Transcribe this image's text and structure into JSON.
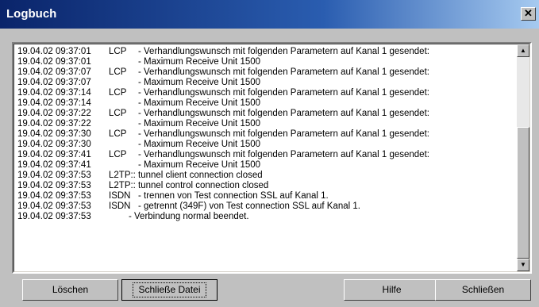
{
  "window": {
    "title": "Logbuch",
    "close_icon": "close-icon"
  },
  "log": {
    "lines": [
      {
        "date": "19.04.02 09:37:01",
        "type": "LCP",
        "message": "- Verhandlungswunsch mit folgenden Parametern auf Kanal 1 gesendet:"
      },
      {
        "date": "19.04.02 09:37:01",
        "type": "",
        "message": "- Maximum Receive Unit 1500"
      },
      {
        "date": "19.04.02 09:37:07",
        "type": "LCP",
        "message": "- Verhandlungswunsch mit folgenden Parametern auf Kanal 1 gesendet:"
      },
      {
        "date": "19.04.02 09:37:07",
        "type": "",
        "message": "- Maximum Receive Unit 1500"
      },
      {
        "date": "19.04.02 09:37:14",
        "type": "LCP",
        "message": "- Verhandlungswunsch mit folgenden Parametern auf Kanal 1 gesendet:"
      },
      {
        "date": "19.04.02 09:37:14",
        "type": "",
        "message": "- Maximum Receive Unit 1500"
      },
      {
        "date": "19.04.02 09:37:22",
        "type": "LCP",
        "message": "- Verhandlungswunsch mit folgenden Parametern auf Kanal 1 gesendet:"
      },
      {
        "date": "19.04.02 09:37:22",
        "type": "",
        "message": "- Maximum Receive Unit 1500"
      },
      {
        "date": "19.04.02 09:37:30",
        "type": "LCP",
        "message": "- Verhandlungswunsch mit folgenden Parametern auf Kanal 1 gesendet:"
      },
      {
        "date": "19.04.02 09:37:30",
        "type": "",
        "message": "- Maximum Receive Unit 1500"
      },
      {
        "date": "19.04.02 09:37:41",
        "type": "LCP",
        "message": "- Verhandlungswunsch mit folgenden Parametern auf Kanal 1 gesendet:"
      },
      {
        "date": "19.04.02 09:37:41",
        "type": "",
        "message": "- Maximum Receive Unit 1500"
      },
      {
        "date": "19.04.02 09:37:53",
        "type": "L2TP::",
        "message": "tunnel client connection closed"
      },
      {
        "date": "19.04.02 09:37:53",
        "type": "L2TP::",
        "message": "tunnel control connection closed"
      },
      {
        "date": "19.04.02 09:37:53",
        "type": "ISDN",
        "message": "- trennen von Test connection SSL auf Kanal 1."
      },
      {
        "date": "19.04.02 09:37:53",
        "type": "ISDN",
        "message": "- getrennt (349F) von Test connection SSL auf Kanal 1."
      },
      {
        "date": "19.04.02 09:37:53",
        "type": "",
        "message": "- Verbindung normal beendet."
      }
    ]
  },
  "scrollbar": {
    "up_icon": "arrow-up-icon",
    "down_icon": "arrow-down-icon",
    "position": 0.55
  },
  "buttons": {
    "delete": "Löschen",
    "close_file": "Schließe Datei",
    "help": "Hilfe",
    "close": "Schließen"
  }
}
